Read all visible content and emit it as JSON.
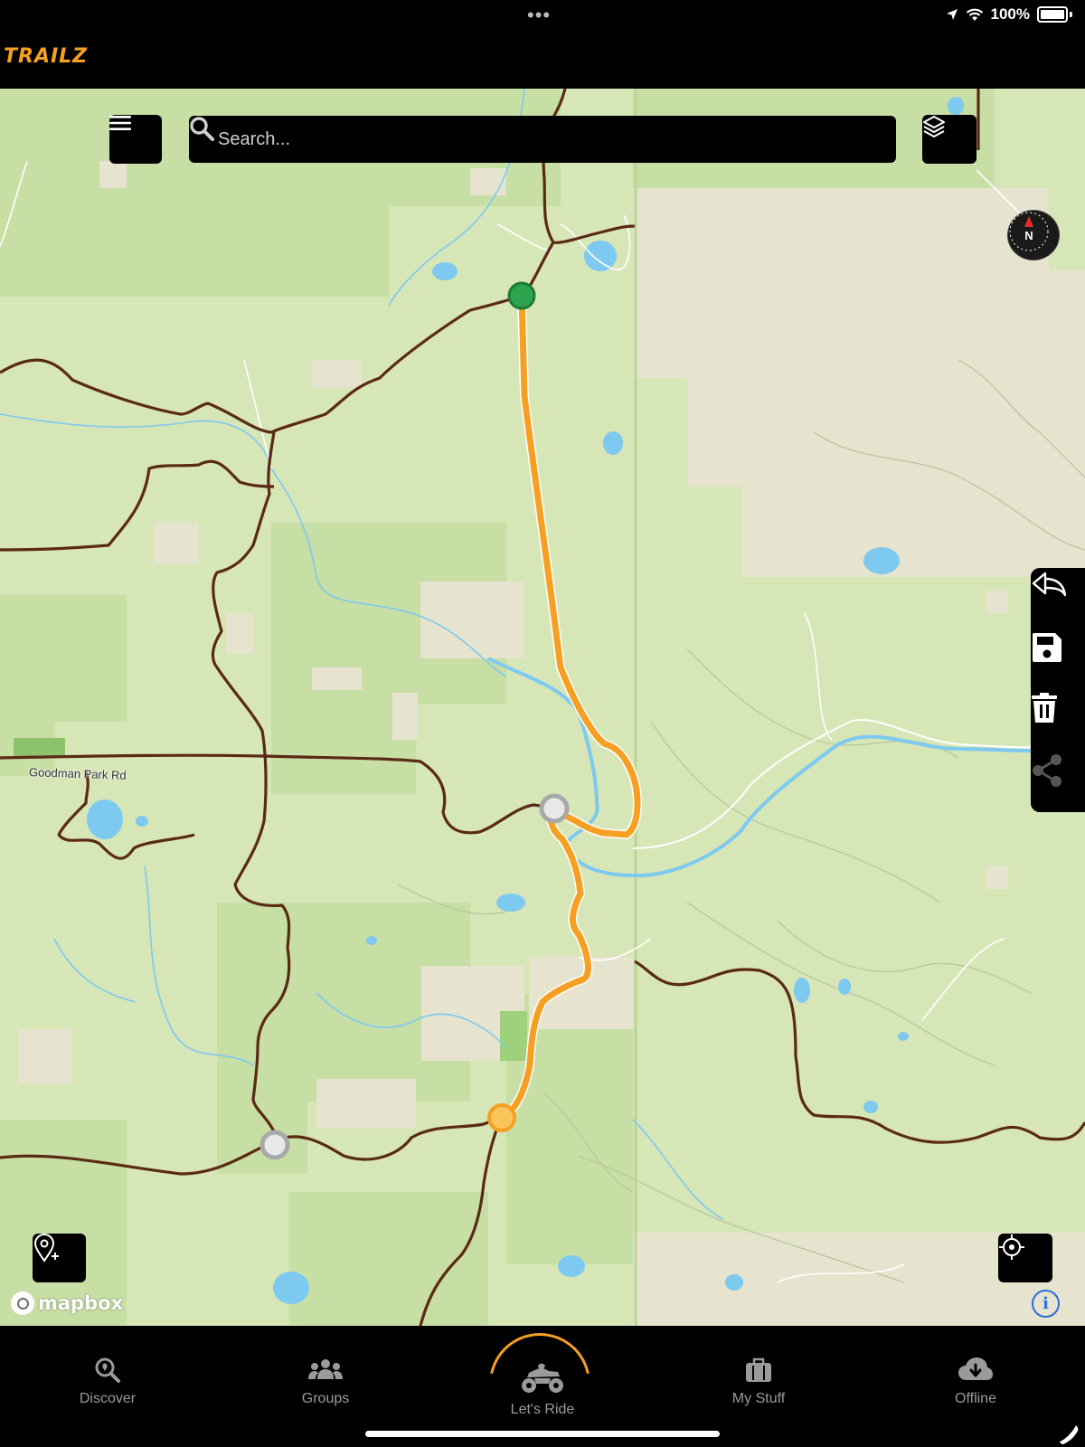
{
  "status_bar": {
    "battery": "100%",
    "dots": "•••"
  },
  "app": {
    "logo": "TRAILZ"
  },
  "search": {
    "placeholder": "Search..."
  },
  "compass": {
    "label": "N"
  },
  "map": {
    "road_label": "Goodman Park Rd",
    "attribution": "mapbox",
    "info": "i"
  },
  "tabs": [
    {
      "label": "Discover",
      "icon": "discover-search-icon",
      "active": false
    },
    {
      "label": "Groups",
      "icon": "groups-icon",
      "active": false
    },
    {
      "label": "Let's Ride",
      "icon": "atv-icon",
      "active": true
    },
    {
      "label": "My Stuff",
      "icon": "briefcase-icon",
      "active": false
    },
    {
      "label": "Offline",
      "icon": "cloud-download-icon",
      "active": false
    }
  ],
  "colors": {
    "route": "#f5a023",
    "road": "#5a2a16",
    "water": "#7ec9ef",
    "map_base": "#d7e6b7",
    "forest": "#c4dda0",
    "start_marker": "#2ea44f"
  }
}
